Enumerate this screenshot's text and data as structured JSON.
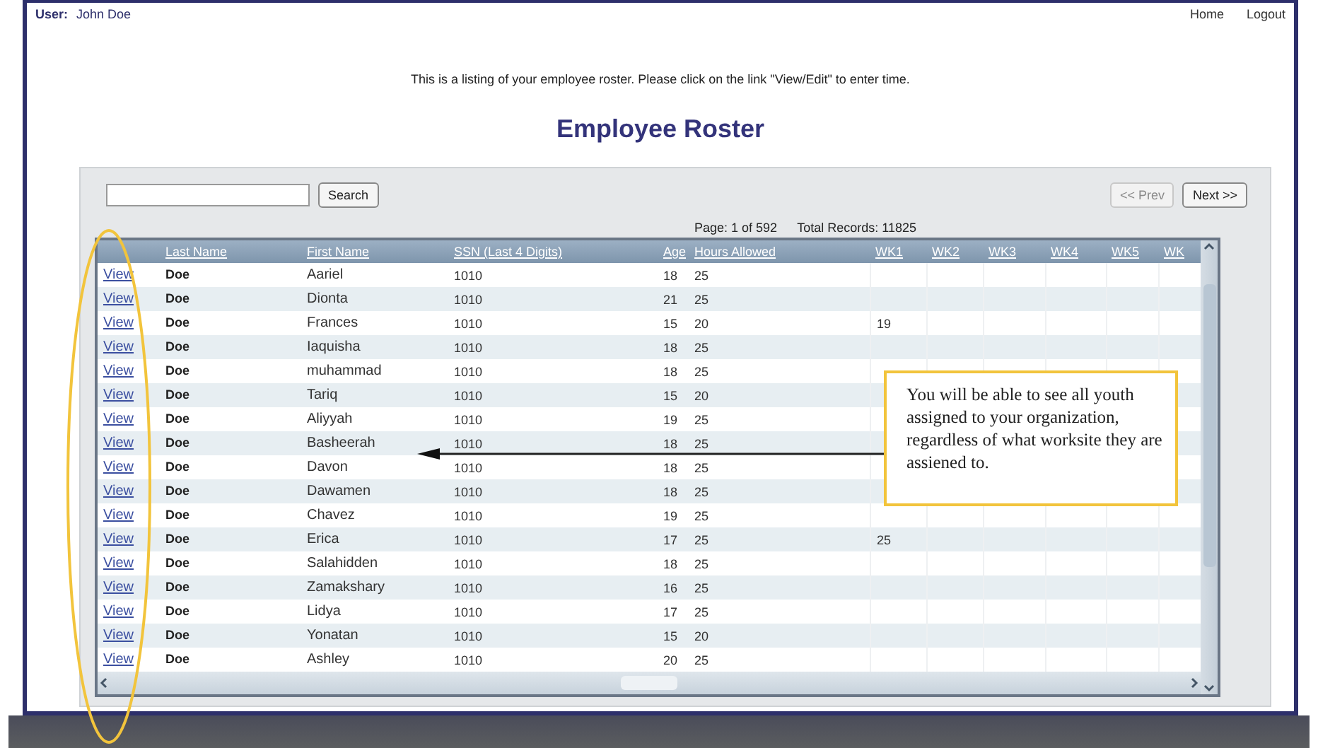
{
  "user": {
    "label": "User:",
    "name": "John Doe"
  },
  "nav": [
    {
      "label": "Home"
    },
    {
      "label": "Logout"
    }
  ],
  "intro": "This is a listing of your employee roster. Please click on the link \"View/Edit\" to enter time.",
  "title": "Employee Roster",
  "search": {
    "button": "Search"
  },
  "pager": {
    "prev": {
      "label": "<< Prev",
      "disabled": true
    },
    "next": {
      "label": "Next >>",
      "disabled": false
    }
  },
  "page_info": "Page: 1 of 592",
  "total_records": "Total Records: 11825",
  "table": {
    "columns": [
      "Last Name",
      "First Name",
      "SSN (Last 4 Digits)",
      "Age",
      "Hours Allowed",
      "WK1",
      "WK2",
      "WK3",
      "WK4",
      "WK5",
      "WK"
    ],
    "rows": [
      {
        "link": "View",
        "last_name": "Doe",
        "first_name": "Aariel",
        "ssn": "1010",
        "age": "18",
        "hours": "25"
      },
      {
        "link": "View",
        "last_name": "Doe",
        "first_name": "Dionta",
        "ssn": "1010",
        "age": "21",
        "hours": "25"
      },
      {
        "link": "View",
        "last_name": "Doe",
        "first_name": "Frances",
        "ssn": "1010",
        "age": "15",
        "hours": "20",
        "wk1": "19"
      },
      {
        "link": "View",
        "last_name": "Doe",
        "first_name": "Iaquisha",
        "ssn": "1010",
        "age": "18",
        "hours": "25"
      },
      {
        "link": "View",
        "last_name": "Doe",
        "first_name": "muhammad",
        "ssn": "1010",
        "age": "18",
        "hours": "25"
      },
      {
        "link": "View",
        "last_name": "Doe",
        "first_name": "Tariq",
        "ssn": "1010",
        "age": "15",
        "hours": "20"
      },
      {
        "link": "View",
        "last_name": "Doe",
        "first_name": "Aliyyah",
        "ssn": "1010",
        "age": "19",
        "hours": "25"
      },
      {
        "link": "View",
        "last_name": "Doe",
        "first_name": "Basheerah",
        "ssn": "1010",
        "age": "18",
        "hours": "25"
      },
      {
        "link": "View",
        "last_name": "Doe",
        "first_name": "Davon",
        "ssn": "1010",
        "age": "18",
        "hours": "25"
      },
      {
        "link": "View",
        "last_name": "Doe",
        "first_name": "Dawamen",
        "ssn": "1010",
        "age": "18",
        "hours": "25"
      },
      {
        "link": "View",
        "last_name": "Doe",
        "first_name": "Chavez",
        "ssn": "1010",
        "age": "19",
        "hours": "25"
      },
      {
        "link": "View",
        "last_name": "Doe",
        "first_name": "Erica",
        "ssn": "1010",
        "age": "17",
        "hours": "25",
        "wk1": "25"
      },
      {
        "link": "View",
        "last_name": "Doe",
        "first_name": "Salahidden",
        "ssn": "1010",
        "age": "18",
        "hours": "25"
      },
      {
        "link": "View",
        "last_name": "Doe",
        "first_name": "Zamakshary",
        "ssn": "1010",
        "age": "16",
        "hours": "25"
      },
      {
        "link": "View",
        "last_name": "Doe",
        "first_name": "Lidya",
        "ssn": "1010",
        "age": "17",
        "hours": "25"
      },
      {
        "link": "View",
        "last_name": "Doe",
        "first_name": "Yonatan",
        "ssn": "1010",
        "age": "15",
        "hours": "20"
      },
      {
        "link": "View",
        "last_name": "Doe",
        "first_name": "Ashley",
        "ssn": "1010",
        "age": "20",
        "hours": "25"
      }
    ]
  },
  "callout": {
    "text": "You will be able to see all youth assigned to your organization, regardless of what worksite they are assiened to."
  }
}
